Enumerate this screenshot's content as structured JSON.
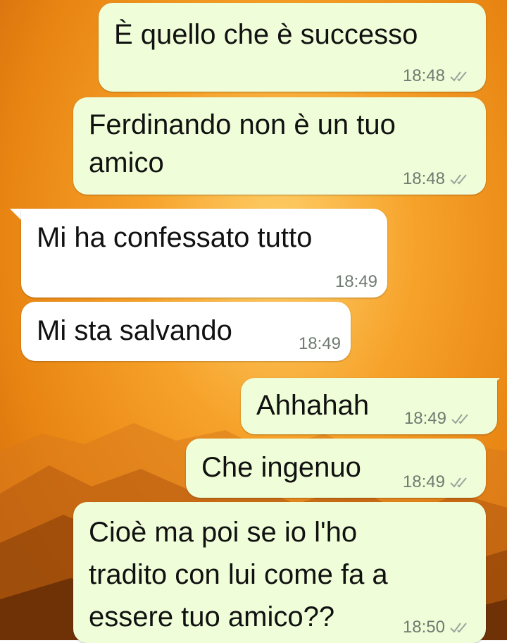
{
  "chat": {
    "messages": [
      {
        "direction": "outgoing",
        "text": "È quello che è successo",
        "time": "18:48",
        "status": "read-ticks"
      },
      {
        "direction": "outgoing",
        "text_lines": [
          "Ferdinando non è un tuo",
          "amico"
        ],
        "time": "18:48",
        "status": "read-ticks"
      },
      {
        "direction": "incoming",
        "text": "Mi ha confessato tutto",
        "time": "18:49"
      },
      {
        "direction": "incoming",
        "text": "Mi sta salvando",
        "time": "18:49"
      },
      {
        "direction": "outgoing",
        "text": "Ahhahah",
        "time": "18:49",
        "status": "read-ticks"
      },
      {
        "direction": "outgoing",
        "text": "Che ingenuo",
        "time": "18:49",
        "status": "read-ticks"
      },
      {
        "direction": "outgoing",
        "text_lines": [
          "Cioè ma poi se io l'ho",
          "tradito con lui come fa a",
          "essere tuo amico??"
        ],
        "time": "18:50",
        "status": "read-ticks"
      }
    ]
  },
  "colors": {
    "outgoing_bubble": "#effed8",
    "incoming_bubble": "#ffffff",
    "meta_text": "#6f7a72",
    "wallpaper": "#f6a22a"
  },
  "icons": {
    "status": "double-check-icon"
  }
}
